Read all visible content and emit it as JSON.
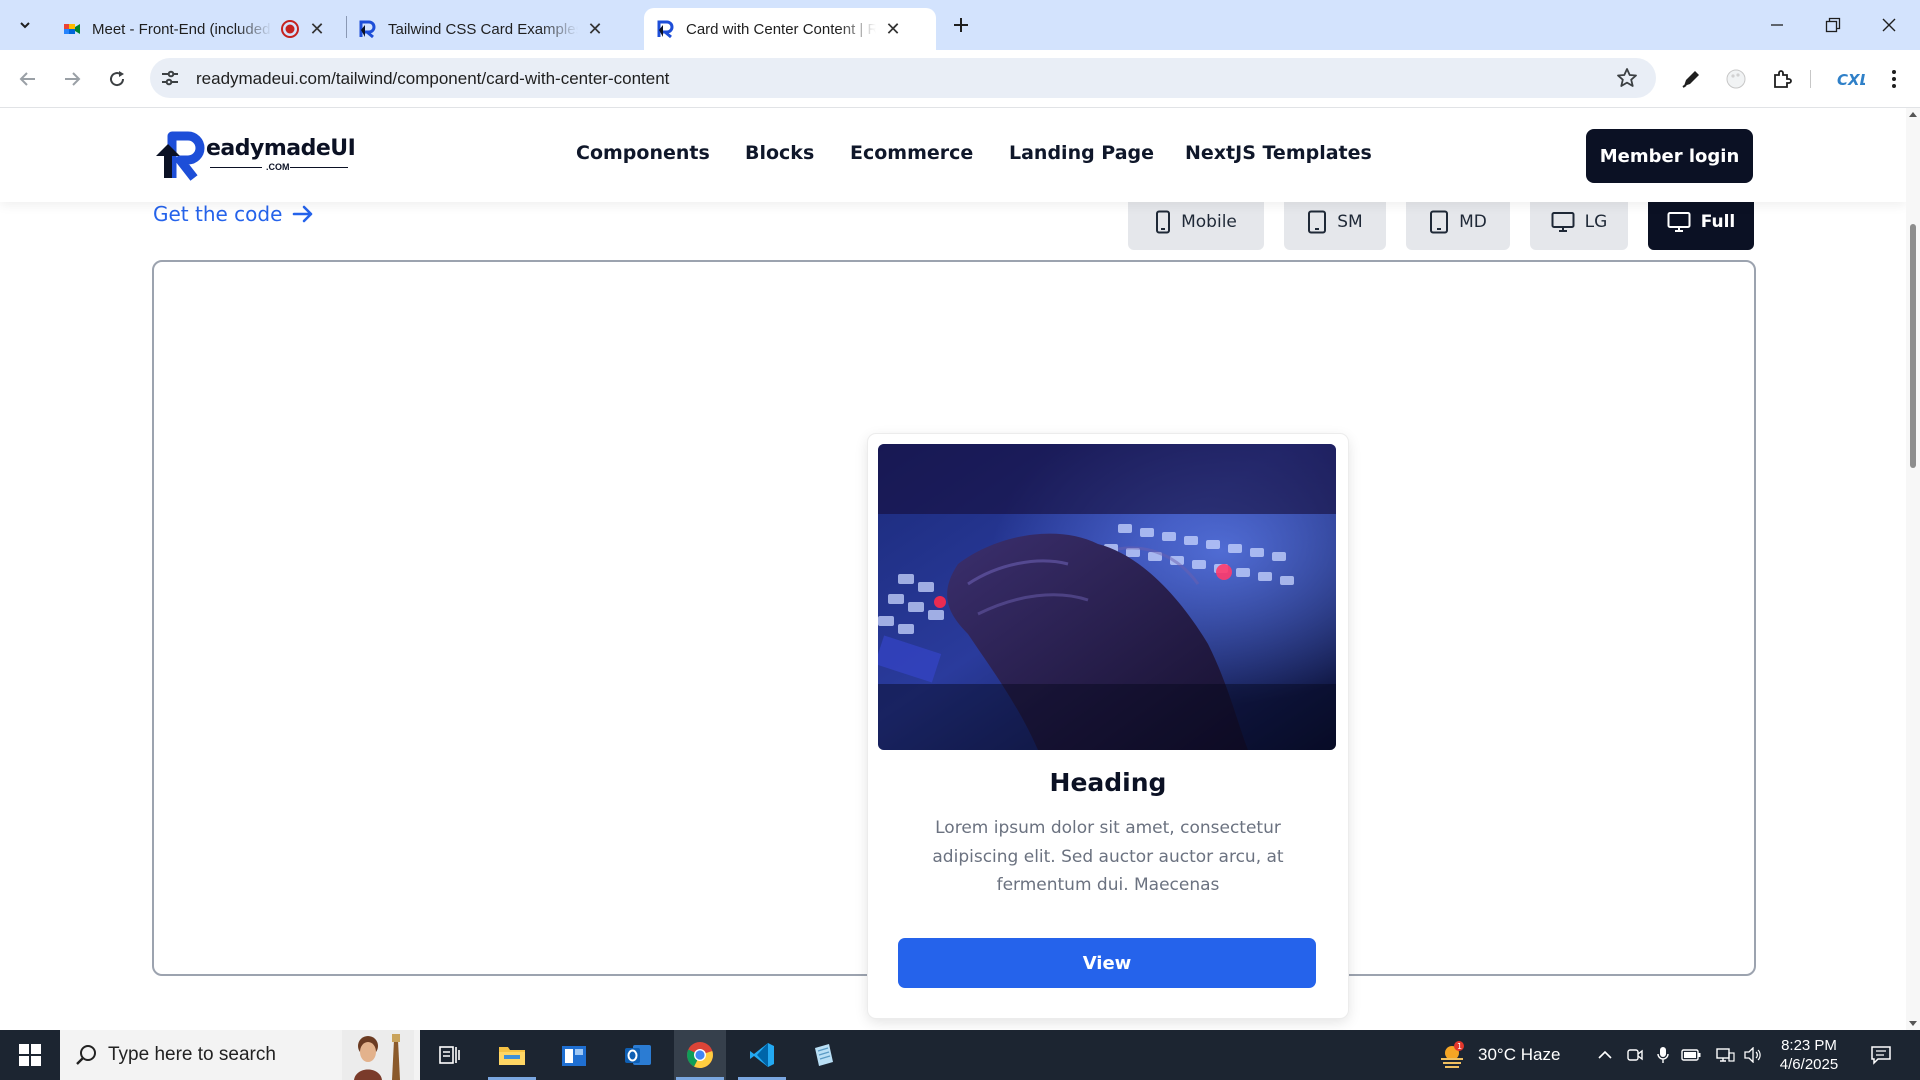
{
  "browser": {
    "tabs": [
      {
        "title": "Meet - Front-End (included",
        "icon": "google-meet-icon",
        "recording": true
      },
      {
        "title": "Tailwind CSS Card Examples | Re",
        "icon": "readymadeui-favicon"
      },
      {
        "title": "Card with Center Content | Rea",
        "icon": "readymadeui-favicon",
        "active": true
      }
    ],
    "url": "readymadeui.com/tailwind/component/card-with-center-content"
  },
  "site": {
    "logo_text": "eadymadeUI",
    "logo_sub": ".COM",
    "nav": [
      "Components",
      "Blocks",
      "Ecommerce",
      "Landing Page",
      "NextJS Templates"
    ],
    "member_login": "Member login",
    "get_code": "Get the code",
    "viewports": [
      {
        "label": "Mobile",
        "icon": "mobile-icon"
      },
      {
        "label": "SM",
        "icon": "tablet-icon"
      },
      {
        "label": "MD",
        "icon": "tablet-icon"
      },
      {
        "label": "LG",
        "icon": "monitor-icon"
      },
      {
        "label": "Full",
        "icon": "monitor-icon",
        "active": true
      }
    ]
  },
  "card": {
    "heading": "Heading",
    "body": "Lorem ipsum dolor sit amet, consectetur adipiscing elit. Sed auctor auctor arcu, at fermentum dui. Maecenas",
    "button": "View",
    "image_alt": "hand-on-keyboard-photo"
  },
  "taskbar": {
    "search_placeholder": "Type here to search",
    "weather": "30°C  Haze",
    "time": "8:23 PM",
    "date": "4/6/2025",
    "weather_badge": "1"
  },
  "colors": {
    "accent": "#2563eb",
    "dark": "#0b1124",
    "tabstrip": "#d3e3fd"
  }
}
